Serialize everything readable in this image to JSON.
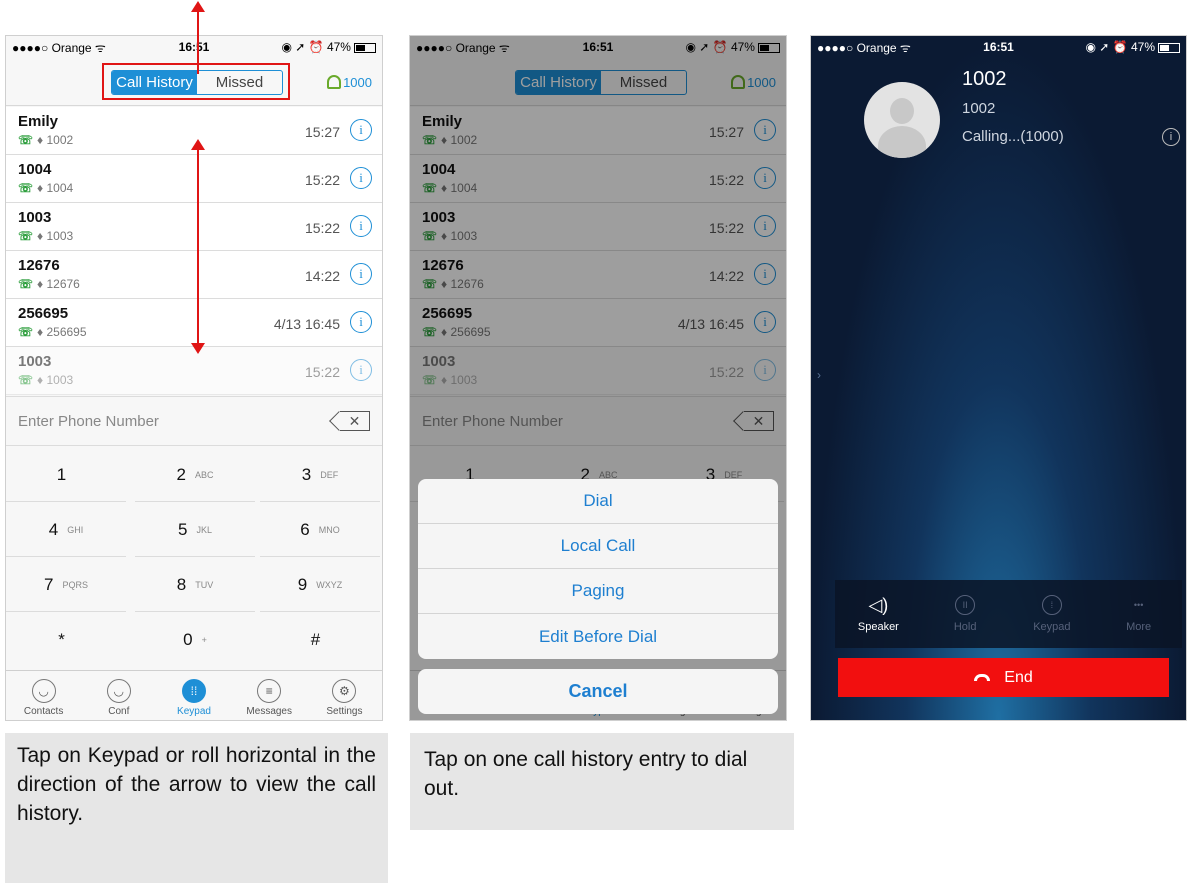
{
  "status": {
    "carrier": "●●●●○ Orange ᯤ",
    "time": "16:51",
    "right": "◉ ➚ ⏰ 47%"
  },
  "header": {
    "tab_history": "Call History",
    "tab_missed": "Missed",
    "account": "1000"
  },
  "history": [
    {
      "name": "Emily",
      "number": "1002",
      "time": "15:27"
    },
    {
      "name": "1004",
      "number": "1004",
      "time": "15:22"
    },
    {
      "name": "1003",
      "number": "1003",
      "time": "15:22"
    },
    {
      "name": "12676",
      "number": "12676",
      "time": "14:22"
    },
    {
      "name": "256695",
      "number": "256695",
      "time": "4/13 16:45"
    },
    {
      "name": "1003",
      "number": "1003",
      "time": "15:22"
    }
  ],
  "input": {
    "placeholder": "Enter Phone Number"
  },
  "keys": [
    {
      "d": "1",
      "l": ""
    },
    {
      "d": "2",
      "l": "ABC"
    },
    {
      "d": "3",
      "l": "DEF"
    },
    {
      "d": "4",
      "l": "GHI"
    },
    {
      "d": "5",
      "l": "JKL"
    },
    {
      "d": "6",
      "l": "MNO"
    },
    {
      "d": "7",
      "l": "PQRS"
    },
    {
      "d": "8",
      "l": "TUV"
    },
    {
      "d": "9",
      "l": "WXYZ"
    },
    {
      "d": "*",
      "l": ""
    },
    {
      "d": "0",
      "l": "+"
    },
    {
      "d": "#",
      "l": ""
    }
  ],
  "tabs": {
    "contacts": "Contacts",
    "conf": "Conf",
    "keypad": "Keypad",
    "messages": "Messages",
    "settings": "Settings"
  },
  "sheet": {
    "dial": "Dial",
    "local": "Local Call",
    "paging": "Paging",
    "edit": "Edit Before Dial",
    "cancel": "Cancel"
  },
  "call": {
    "name": "1002",
    "number": "1002",
    "status": "Calling...(1000)",
    "speaker": "Speaker",
    "hold": "Hold",
    "keypad": "Keypad",
    "more": "More",
    "end": "End"
  },
  "captions": {
    "first": "Tap on Keypad or roll horizontal in the direction of the arrow to view the call history.",
    "second": "Tap on one call history entry to dial out."
  },
  "colors": {
    "accent": "#1e8fd6",
    "end_red": "#f20f0f",
    "annotation_red": "#e01515"
  }
}
